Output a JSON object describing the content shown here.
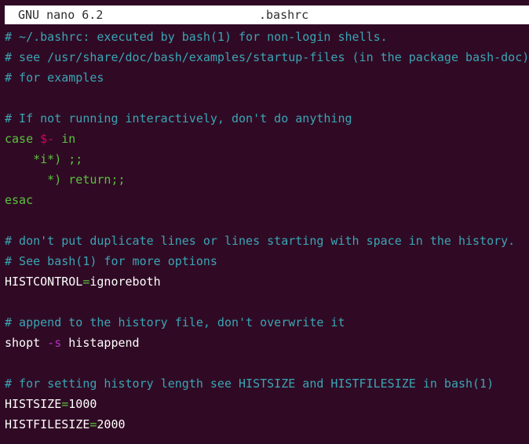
{
  "window": {
    "app_title": "GNU nano 6.2",
    "filename": ".bashrc"
  },
  "colors": {
    "background": "#300a24",
    "titlebar_bg": "#ffffff",
    "titlebar_text": "#2e2e2e",
    "comment": "#3aa5b5",
    "keyword": "#59c23d",
    "variable": "#d7005f",
    "option": "#b035c0",
    "default": "#ffffff"
  },
  "editor": {
    "lines": [
      [
        {
          "text": "# ~/.bashrc: executed by bash(1) for non-login shells.",
          "color": "#3aa5b5"
        }
      ],
      [
        {
          "text": "# see /usr/share/doc/bash/examples/startup-files (in the package bash-doc)",
          "color": "#3aa5b5"
        }
      ],
      [
        {
          "text": "# for examples",
          "color": "#3aa5b5"
        }
      ],
      [],
      [
        {
          "text": "# If not running interactively, don't do anything",
          "color": "#3aa5b5"
        }
      ],
      [
        {
          "text": "case ",
          "color": "#59c23d"
        },
        {
          "text": "$-",
          "color": "#d7005f"
        },
        {
          "text": " in",
          "color": "#59c23d"
        }
      ],
      [
        {
          "text": "    *i*) ;;",
          "color": "#59c23d"
        }
      ],
      [
        {
          "text": "      *) ",
          "color": "#59c23d"
        },
        {
          "text": "return",
          "color": "#59c23d"
        },
        {
          "text": ";;",
          "color": "#59c23d"
        }
      ],
      [
        {
          "text": "esac",
          "color": "#59c23d"
        }
      ],
      [],
      [
        {
          "text": "# don't put duplicate lines or lines starting with space in the history.",
          "color": "#3aa5b5"
        }
      ],
      [
        {
          "text": "# See bash(1) for more options",
          "color": "#3aa5b5"
        }
      ],
      [
        {
          "text": "HISTCONTROL",
          "color": "#ffffff"
        },
        {
          "text": "=",
          "color": "#59c23d"
        },
        {
          "text": "ignoreboth",
          "color": "#ffffff"
        }
      ],
      [],
      [
        {
          "text": "# append to the history file, don't overwrite it",
          "color": "#3aa5b5"
        }
      ],
      [
        {
          "text": "shopt ",
          "color": "#ffffff"
        },
        {
          "text": "-s",
          "color": "#b035c0"
        },
        {
          "text": " histappend",
          "color": "#ffffff"
        }
      ],
      [],
      [
        {
          "text": "# for setting history length see HISTSIZE and HISTFILESIZE in bash(1)",
          "color": "#3aa5b5"
        }
      ],
      [
        {
          "text": "HISTSIZE",
          "color": "#ffffff"
        },
        {
          "text": "=",
          "color": "#59c23d"
        },
        {
          "text": "1000",
          "color": "#ffffff"
        }
      ],
      [
        {
          "text": "HISTFILESIZE",
          "color": "#ffffff"
        },
        {
          "text": "=",
          "color": "#59c23d"
        },
        {
          "text": "2000",
          "color": "#ffffff"
        }
      ]
    ]
  }
}
